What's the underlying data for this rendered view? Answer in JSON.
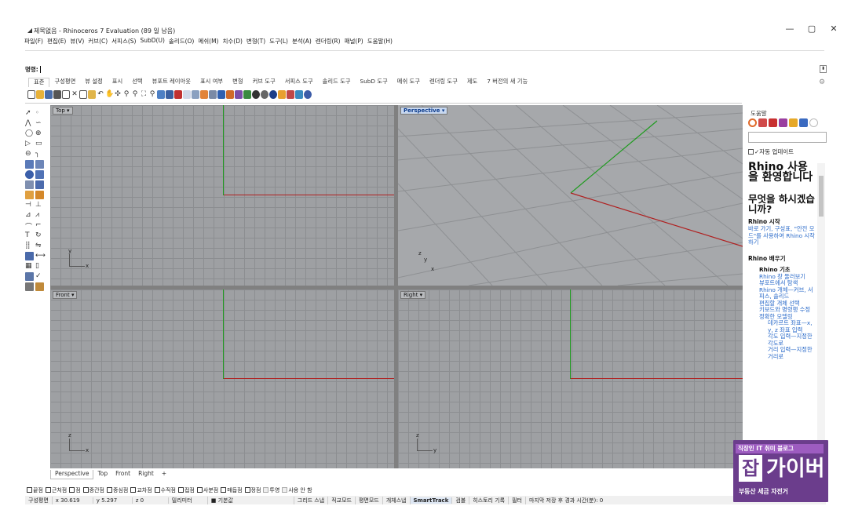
{
  "window": {
    "title": "제목없음 - Rhinoceros 7 Evaluation (89 일 남음)",
    "minimize": "—",
    "maximize": "▢",
    "close": "✕"
  },
  "menu": [
    "파일(F)",
    "편집(E)",
    "뷰(V)",
    "커브(C)",
    "서피스(S)",
    "SubD(U)",
    "솔리드(O)",
    "메쉬(M)",
    "치수(D)",
    "변형(T)",
    "도구(L)",
    "분석(A)",
    "렌더링(R)",
    "패널(P)",
    "도움말(H)"
  ],
  "command": {
    "label": "명령:",
    "scroll": "⬍"
  },
  "tabs": [
    "표준",
    "구성평면",
    "뷰 설정",
    "표시",
    "선택",
    "뷰포트 레이아웃",
    "표시 여부",
    "변형",
    "커브 도구",
    "서피스 도구",
    "솔리드 도구",
    "SubD 도구",
    "메쉬 도구",
    "렌더링 도구",
    "제도",
    "7 버전의 새 기능"
  ],
  "tab_settings_icon": "gear-icon",
  "viewports": {
    "top": {
      "title": "Top",
      "axis_y": "y",
      "axis_x": "x"
    },
    "perspective": {
      "title": "Perspective",
      "axis_z": "z",
      "axis_y": "y",
      "axis_x": "x"
    },
    "front": {
      "title": "Front",
      "axis_z": "z",
      "axis_x": "x"
    },
    "right": {
      "title": "Right",
      "axis_z": "z",
      "axis_y": "y"
    }
  },
  "viewport_tabs": [
    "Perspective",
    "Top",
    "Front",
    "Right",
    "+"
  ],
  "osnaps": [
    {
      "label": "끝점",
      "checked": false
    },
    {
      "label": "근처점",
      "checked": false
    },
    {
      "label": "점",
      "checked": false
    },
    {
      "label": "중간점",
      "checked": false
    },
    {
      "label": "중심점",
      "checked": false
    },
    {
      "label": "교차점",
      "checked": false
    },
    {
      "label": "수직점",
      "checked": false
    },
    {
      "label": "접점",
      "checked": false
    },
    {
      "label": "사분점",
      "checked": false
    },
    {
      "label": "매듭점",
      "checked": false
    },
    {
      "label": "정점",
      "checked": false
    },
    {
      "label": "투영",
      "checked": false,
      "disabled": true
    },
    {
      "label": "사용 안 함",
      "checked": false,
      "disabled": true
    }
  ],
  "status": {
    "cplane": "구성평면",
    "x": "x 30.619",
    "y": "y 5.297",
    "z": "z 0",
    "units": "밀리미터",
    "layer": "■ 기본값",
    "grid_snap": "그리드 스냅",
    "ortho": "직교모드",
    "planar": "평면모드",
    "osnap": "개체스냅",
    "smarttrack": "SmartTrack",
    "gumball": "검볼",
    "history": "히스토리 기록",
    "filter": "필터",
    "autosave": "마지막 저장 후 경과 시간(분): 0"
  },
  "panel": {
    "title": "도움말",
    "auto_update": "자동 업데이트",
    "welcome": "Rhino 사용을 환영합니다",
    "question": "무엇을 하시겠습니까?",
    "start_heading": "Rhino 시작",
    "start_link": "바로 가기, 구성표, \"안전 모드\"를 사용하여 Rhino 시작하기",
    "learn_heading": "Rhino 배우기",
    "basics": "Rhino 기초",
    "links": [
      "Rhino 창 둘러보기",
      "뷰포트에서 탐색",
      "Rhino 개체—커브, 서피스, 솔리드",
      "편집할 개체 선택",
      "키보드와 명령행 수정",
      "정확한 모델링"
    ],
    "sublinks": [
      "데카르트 좌표—x, y, z 좌표 입력",
      "각도 입력—지정한 각도로",
      "거리 입력—지정한 거리로"
    ]
  },
  "watermark": {
    "top": "직장인 IT 취미 블로그",
    "brand_a": "잡",
    "brand_b": "가이버",
    "bottom": "부동산 세금 자전거"
  }
}
